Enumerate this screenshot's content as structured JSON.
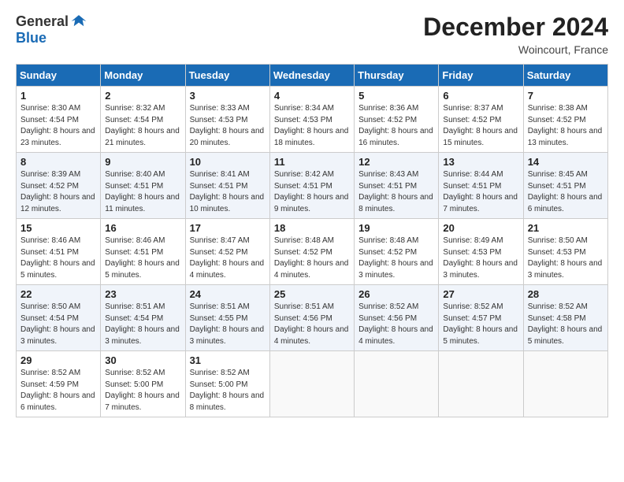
{
  "header": {
    "logo_general": "General",
    "logo_blue": "Blue",
    "month_title": "December 2024",
    "location": "Woincourt, France"
  },
  "calendar": {
    "days_of_week": [
      "Sunday",
      "Monday",
      "Tuesday",
      "Wednesday",
      "Thursday",
      "Friday",
      "Saturday"
    ],
    "weeks": [
      [
        {
          "day": 1,
          "sunrise": "8:30 AM",
          "sunset": "4:54 PM",
          "daylight": "8 hours and 23 minutes"
        },
        {
          "day": 2,
          "sunrise": "8:32 AM",
          "sunset": "4:54 PM",
          "daylight": "8 hours and 21 minutes"
        },
        {
          "day": 3,
          "sunrise": "8:33 AM",
          "sunset": "4:53 PM",
          "daylight": "8 hours and 20 minutes"
        },
        {
          "day": 4,
          "sunrise": "8:34 AM",
          "sunset": "4:53 PM",
          "daylight": "8 hours and 18 minutes"
        },
        {
          "day": 5,
          "sunrise": "8:36 AM",
          "sunset": "4:52 PM",
          "daylight": "8 hours and 16 minutes"
        },
        {
          "day": 6,
          "sunrise": "8:37 AM",
          "sunset": "4:52 PM",
          "daylight": "8 hours and 15 minutes"
        },
        {
          "day": 7,
          "sunrise": "8:38 AM",
          "sunset": "4:52 PM",
          "daylight": "8 hours and 13 minutes"
        }
      ],
      [
        {
          "day": 8,
          "sunrise": "8:39 AM",
          "sunset": "4:52 PM",
          "daylight": "8 hours and 12 minutes"
        },
        {
          "day": 9,
          "sunrise": "8:40 AM",
          "sunset": "4:51 PM",
          "daylight": "8 hours and 11 minutes"
        },
        {
          "day": 10,
          "sunrise": "8:41 AM",
          "sunset": "4:51 PM",
          "daylight": "8 hours and 10 minutes"
        },
        {
          "day": 11,
          "sunrise": "8:42 AM",
          "sunset": "4:51 PM",
          "daylight": "8 hours and 9 minutes"
        },
        {
          "day": 12,
          "sunrise": "8:43 AM",
          "sunset": "4:51 PM",
          "daylight": "8 hours and 8 minutes"
        },
        {
          "day": 13,
          "sunrise": "8:44 AM",
          "sunset": "4:51 PM",
          "daylight": "8 hours and 7 minutes"
        },
        {
          "day": 14,
          "sunrise": "8:45 AM",
          "sunset": "4:51 PM",
          "daylight": "8 hours and 6 minutes"
        }
      ],
      [
        {
          "day": 15,
          "sunrise": "8:46 AM",
          "sunset": "4:51 PM",
          "daylight": "8 hours and 5 minutes"
        },
        {
          "day": 16,
          "sunrise": "8:46 AM",
          "sunset": "4:51 PM",
          "daylight": "8 hours and 5 minutes"
        },
        {
          "day": 17,
          "sunrise": "8:47 AM",
          "sunset": "4:52 PM",
          "daylight": "8 hours and 4 minutes"
        },
        {
          "day": 18,
          "sunrise": "8:48 AM",
          "sunset": "4:52 PM",
          "daylight": "8 hours and 4 minutes"
        },
        {
          "day": 19,
          "sunrise": "8:48 AM",
          "sunset": "4:52 PM",
          "daylight": "8 hours and 3 minutes"
        },
        {
          "day": 20,
          "sunrise": "8:49 AM",
          "sunset": "4:53 PM",
          "daylight": "8 hours and 3 minutes"
        },
        {
          "day": 21,
          "sunrise": "8:50 AM",
          "sunset": "4:53 PM",
          "daylight": "8 hours and 3 minutes"
        }
      ],
      [
        {
          "day": 22,
          "sunrise": "8:50 AM",
          "sunset": "4:54 PM",
          "daylight": "8 hours and 3 minutes"
        },
        {
          "day": 23,
          "sunrise": "8:51 AM",
          "sunset": "4:54 PM",
          "daylight": "8 hours and 3 minutes"
        },
        {
          "day": 24,
          "sunrise": "8:51 AM",
          "sunset": "4:55 PM",
          "daylight": "8 hours and 3 minutes"
        },
        {
          "day": 25,
          "sunrise": "8:51 AM",
          "sunset": "4:56 PM",
          "daylight": "8 hours and 4 minutes"
        },
        {
          "day": 26,
          "sunrise": "8:52 AM",
          "sunset": "4:56 PM",
          "daylight": "8 hours and 4 minutes"
        },
        {
          "day": 27,
          "sunrise": "8:52 AM",
          "sunset": "4:57 PM",
          "daylight": "8 hours and 5 minutes"
        },
        {
          "day": 28,
          "sunrise": "8:52 AM",
          "sunset": "4:58 PM",
          "daylight": "8 hours and 5 minutes"
        }
      ],
      [
        {
          "day": 29,
          "sunrise": "8:52 AM",
          "sunset": "4:59 PM",
          "daylight": "8 hours and 6 minutes"
        },
        {
          "day": 30,
          "sunrise": "8:52 AM",
          "sunset": "5:00 PM",
          "daylight": "8 hours and 7 minutes"
        },
        {
          "day": 31,
          "sunrise": "8:52 AM",
          "sunset": "5:00 PM",
          "daylight": "8 hours and 8 minutes"
        },
        null,
        null,
        null,
        null
      ]
    ]
  }
}
